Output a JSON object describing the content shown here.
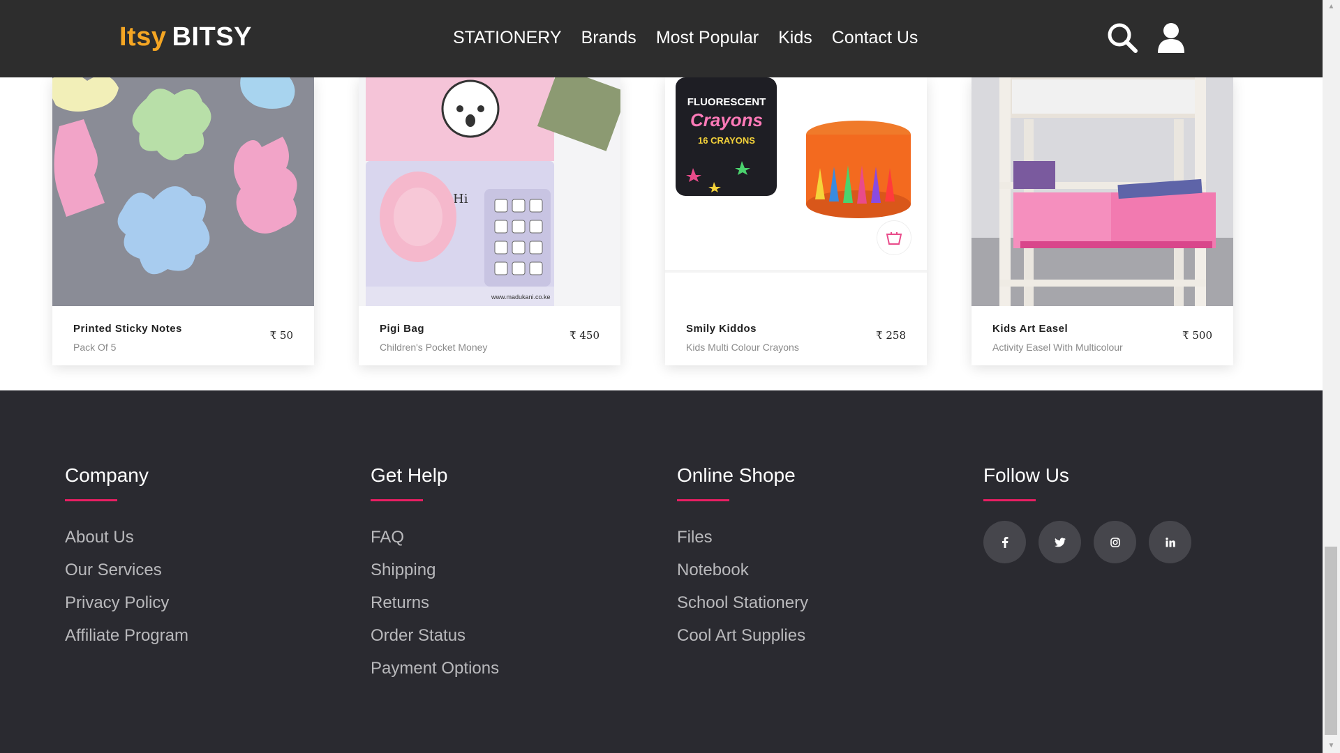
{
  "header": {
    "logo_part1": "Itsy",
    "logo_part2": "BITSY",
    "nav": [
      "STATIONERY",
      "Brands",
      "Most Popular",
      "Kids",
      "Contact Us"
    ]
  },
  "products": [
    {
      "name": "Printed Sticky Notes",
      "subtitle": "Pack Of 5",
      "price": "₹ 50"
    },
    {
      "name": "Pigi Bag",
      "subtitle": "Children's Pocket Money",
      "price": "₹ 450"
    },
    {
      "name": "Smily Kiddos",
      "subtitle": "Kids Multi Colour Crayons",
      "price": "₹ 258"
    },
    {
      "name": "Kids Art Easel",
      "subtitle": "Activity Easel With Multicolour",
      "price": "₹ 500"
    }
  ],
  "images": {
    "crayon_can_text1": "FLUORESCENT",
    "crayon_can_text2": "Crayons",
    "crayon_can_text3": "16 CRAYONS",
    "pigi_url": "www.madukani.co.ke",
    "pigi_hi": "Hi"
  },
  "footer": {
    "company": {
      "title": "Company",
      "links": [
        "About Us",
        "Our Services",
        "Privacy Policy",
        "Affiliate Program"
      ]
    },
    "help": {
      "title": "Get Help",
      "links": [
        "FAQ",
        "Shipping",
        "Returns",
        "Order Status",
        "Payment Options"
      ]
    },
    "shop": {
      "title": "Online Shope",
      "links": [
        "Files",
        "Notebook",
        "School Stationery",
        "Cool Art Supplies"
      ]
    },
    "follow": {
      "title": "Follow Us",
      "socials": [
        "f",
        "t",
        "ig",
        "in"
      ]
    }
  },
  "colors": {
    "accent": "#e91e63",
    "logo": "#f5a623",
    "header_bg": "#2d2d2d",
    "footer_bg": "#2a2a30"
  }
}
